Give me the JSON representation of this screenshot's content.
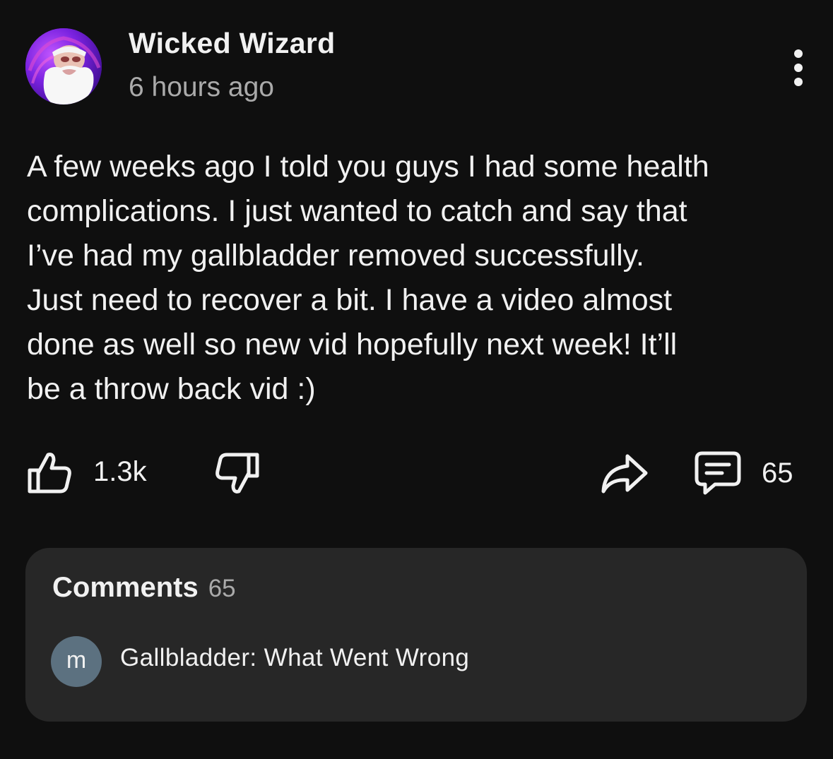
{
  "post": {
    "author": "Wicked Wizard",
    "time": "6 hours ago",
    "avatar_icon": "wizard-avatar",
    "menu_icon": "more-vertical-icon",
    "text": "A few weeks ago I told you guys I had some health\ncomplications. I just wanted to catch and say that\nI’ve had my gallbladder removed successfully.\nJust need to recover a bit. I have a video almost\ndone as well so new vid hopefully next week! It’ll\nbe a throw back vid :)"
  },
  "actions": {
    "like_icon": "thumbs-up-icon",
    "like_count": "1.3k",
    "dislike_icon": "thumbs-down-icon",
    "share_icon": "share-icon",
    "comment_icon": "comment-icon",
    "comment_count": "65"
  },
  "comments": {
    "title": "Comments",
    "count": "65",
    "top_comment": {
      "avatar_letter": "m",
      "text": "Gallbladder: What Went Wrong"
    }
  },
  "colors": {
    "background": "#0f0f0f",
    "card": "#272727",
    "text": "#f1f1f1",
    "secondary_text": "#aaaaaa",
    "comment_avatar": "#5c7180"
  }
}
